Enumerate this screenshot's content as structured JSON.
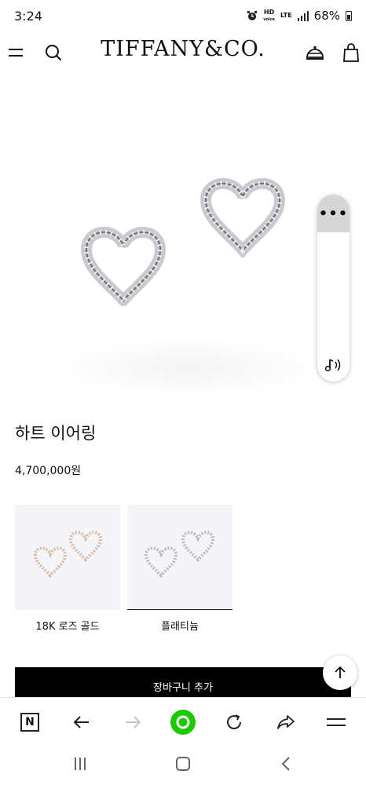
{
  "status": {
    "time": "3:24",
    "hd_label_top": "HD",
    "hd_label_bottom": "voice",
    "lte_label": "LTE",
    "battery": "68%"
  },
  "header": {
    "brand": "TIFFANY&CO."
  },
  "product": {
    "title": "하트 이어링",
    "price": "4,700,000원"
  },
  "variants": [
    {
      "label": "18K 로즈 골드",
      "selected": false
    },
    {
      "label": "플래티늄",
      "selected": true
    }
  ],
  "cart": {
    "button_label": "장바구니 추가"
  },
  "floating_panel": {
    "menu_glyph": "•••"
  },
  "browser": {
    "home_glyph": "N"
  },
  "colors": {
    "accent_green": "#1ec800",
    "cart_button": "#000000",
    "panel_top": "#d6d6d6"
  }
}
